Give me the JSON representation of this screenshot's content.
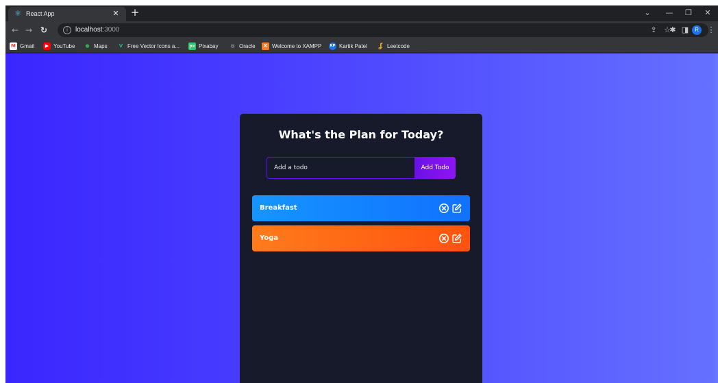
{
  "browser": {
    "tab": {
      "title": "React App"
    },
    "address": {
      "host": "localhost",
      "port": ":3000"
    },
    "bookmarks": [
      {
        "label": "Gmail",
        "icon": "gmail-icon",
        "color": "#ea4335",
        "glyph": "M"
      },
      {
        "label": "YouTube",
        "icon": "youtube-icon",
        "color": "#ff0000",
        "glyph": "▶"
      },
      {
        "label": "Maps",
        "icon": "maps-icon",
        "color": "#34a853",
        "glyph": "●"
      },
      {
        "label": "Free Vector Icons a...",
        "icon": "vector-icon",
        "color": "#29b573",
        "glyph": "V"
      },
      {
        "label": "Pixabay",
        "icon": "pixabay-icon",
        "color": "#2ec66d",
        "glyph": "px"
      },
      {
        "label": "Oracle",
        "icon": "oracle-icon",
        "color": "#5f6368",
        "glyph": "◎"
      },
      {
        "label": "Welcome to XAMPP",
        "icon": "xampp-icon",
        "color": "#fb7a24",
        "glyph": "X"
      },
      {
        "label": "Kartik Patel",
        "icon": "kartik-icon",
        "color": "#1a73e8",
        "glyph": "KP"
      },
      {
        "label": "Leetcode",
        "icon": "leetcode-icon",
        "color": "#ffa116",
        "glyph": "ʆ"
      }
    ],
    "profile_initial": "R"
  },
  "app": {
    "title": "What's the Plan for Today?",
    "input": {
      "placeholder": "Add a todo",
      "value": ""
    },
    "add_button": "Add Todo",
    "todos": [
      {
        "text": "Breakfast",
        "color": "#1595ff"
      },
      {
        "text": "Yoga",
        "color": "#ff6a15"
      }
    ],
    "colors": {
      "background_start": "#3a26ff",
      "background_end": "#6570ff",
      "card": "#161a2b",
      "accent": "#8f14f5"
    }
  }
}
